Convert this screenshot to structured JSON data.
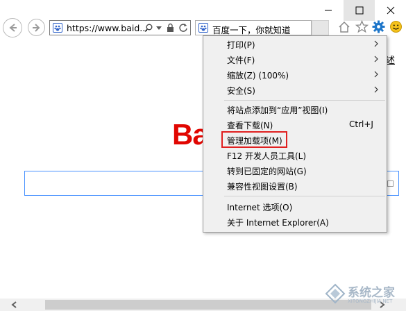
{
  "window": {
    "controls": {
      "minimize_icon": "minimize-icon",
      "maximize_icon": "maximize-icon",
      "close_icon": "close-icon"
    }
  },
  "navbar": {
    "address_text": "https://www.baid...",
    "tab_title": "百度一下，你就知道"
  },
  "page": {
    "logo_text": "Ba",
    "top_right_text": "述"
  },
  "menu": {
    "items": [
      {
        "label": "打印(P)",
        "submenu": true
      },
      {
        "label": "文件(F)",
        "submenu": true
      },
      {
        "label": "缩放(Z) (100%)",
        "submenu": true
      },
      {
        "label": "安全(S)",
        "submenu": true
      },
      {
        "label": "将站点添加到“应用”视图(I)"
      },
      {
        "label": "查看下载(N)",
        "shortcut": "Ctrl+J"
      },
      {
        "label": "管理加载项(M)",
        "highlighted": true
      },
      {
        "label": "F12 开发人员工具(L)"
      },
      {
        "label": "转到已固定的网站(G)"
      },
      {
        "label": "兼容性视图设置(B)"
      },
      {
        "label": "Internet 选项(O)"
      },
      {
        "label": "关于 Internet Explorer(A)"
      }
    ]
  },
  "watermark": {
    "text": "系统之家",
    "sub": "XITONGZHIJIA.NET"
  },
  "colors": {
    "accent": "#e02020",
    "baidu_red": "#e10601",
    "ie_blue": "#2f62c9",
    "settings_blue": "#1e76c9"
  }
}
